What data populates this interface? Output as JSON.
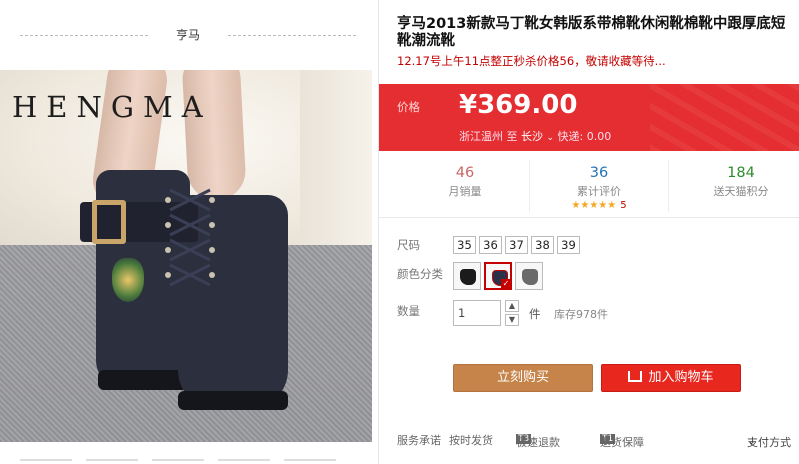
{
  "brand": {
    "name": "亨马"
  },
  "image": {
    "watermark": "HENGMA"
  },
  "product": {
    "title": "亨马2013新款马丁靴女韩版系带棉靴休闲靴棉靴中跟厚底短靴潮流靴",
    "subtitle": "12.17号上午11点整正秒杀价格56，敬请收藏等待..."
  },
  "price": {
    "label": "价格",
    "value": "¥369.00",
    "ship_from": "浙江温州",
    "ship_to_word": "至",
    "ship_to": "长沙",
    "delivery": "快递: 0.00"
  },
  "stats": {
    "monthly_sales": {
      "value": "46",
      "label": "月销量"
    },
    "reviews": {
      "value": "36",
      "label": "累计评价",
      "stars": "★★★★★",
      "score": "5"
    },
    "points": {
      "value": "184",
      "label": "送天猫积分"
    }
  },
  "options": {
    "size_label": "尺码",
    "sizes": [
      "35",
      "36",
      "37",
      "38",
      "39"
    ],
    "color_label": "颜色分类",
    "colors": [
      {
        "name": "black",
        "hex": "#1b1b1b",
        "selected": false
      },
      {
        "name": "navy",
        "hex": "#2b2f48",
        "selected": true
      },
      {
        "name": "grey",
        "hex": "#6a6a6a",
        "selected": false
      }
    ],
    "color_selected_mark": "✓"
  },
  "quantity": {
    "label": "数量",
    "value": "1",
    "unit": "件",
    "stock": "库存978件"
  },
  "actions": {
    "buy_now": "立刻购买",
    "add_cart": "加入购物车"
  },
  "service": {
    "label": "服务承诺",
    "item1": "按时发货",
    "tag2": "T3",
    "item2": "极速退款",
    "tag3": "T1",
    "item3": "退货保障",
    "delivery": "支付方式"
  },
  "colors": {
    "accent": "#e42e31",
    "buy": "#c6844a",
    "cart": "#e8271f"
  }
}
